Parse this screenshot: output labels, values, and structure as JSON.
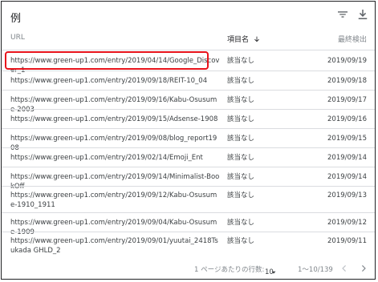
{
  "header": {
    "title": "例"
  },
  "columns": {
    "url": "URL",
    "status": "項目名",
    "last_crawled": "最終検出"
  },
  "rows": [
    {
      "url": "https://www.green-up1.com/entry/2019/04/14/Google_Discover_1",
      "status": "該当なし",
      "date": "2019/09/19"
    },
    {
      "url": "https://www.green-up1.com/entry/2019/09/18/REIT-10_04",
      "status": "該当なし",
      "date": "2019/09/18"
    },
    {
      "url": "https://www.green-up1.com/entry/2019/09/16/Kabu-Osusume-2003",
      "status": "該当なし",
      "date": "2019/09/17"
    },
    {
      "url": "https://www.green-up1.com/entry/2019/09/15/Adsense-1908",
      "status": "該当なし",
      "date": "2019/09/16"
    },
    {
      "url": "https://www.green-up1.com/entry/2019/09/08/blog_report1908",
      "status": "該当なし",
      "date": "2019/09/15"
    },
    {
      "url": "https://www.green-up1.com/entry/2019/02/14/Emoji_Ent",
      "status": "該当なし",
      "date": "2019/09/14"
    },
    {
      "url": "https://www.green-up1.com/entry/2019/09/14/Minimalist-BookOff",
      "status": "該当なし",
      "date": "2019/09/14"
    },
    {
      "url": "https://www.green-up1.com/entry/2019/09/12/Kabu-Osusume-1910_1911",
      "status": "該当なし",
      "date": "2019/09/13"
    },
    {
      "url": "https://www.green-up1.com/entry/2019/09/04/Kabu-Osusume-1909",
      "status": "該当なし",
      "date": "2019/09/12"
    },
    {
      "url": "https://www.green-up1.com/entry/2019/09/01/yuutai_2418Tsukada GHLD_2",
      "status": "該当なし",
      "date": "2019/09/11"
    }
  ],
  "footer": {
    "rows_label": "1 ページあたりの行数:",
    "rows_value": "10",
    "range": "1〜10/139"
  },
  "icons": {
    "filter": "filter-icon",
    "download": "download-icon",
    "sort": "sort-arrow-down-icon"
  },
  "colors": {
    "highlight": "#e8141c",
    "border": "#202124"
  }
}
